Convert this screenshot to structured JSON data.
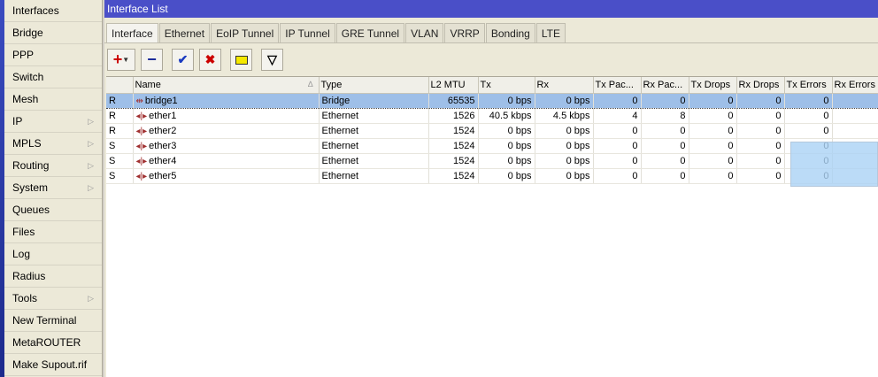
{
  "sidebar": {
    "items": [
      {
        "label": "Interfaces",
        "submenu": false
      },
      {
        "label": "Bridge",
        "submenu": false
      },
      {
        "label": "PPP",
        "submenu": false
      },
      {
        "label": "Switch",
        "submenu": false
      },
      {
        "label": "Mesh",
        "submenu": false
      },
      {
        "label": "IP",
        "submenu": true
      },
      {
        "label": "MPLS",
        "submenu": true
      },
      {
        "label": "Routing",
        "submenu": true
      },
      {
        "label": "System",
        "submenu": true
      },
      {
        "label": "Queues",
        "submenu": false
      },
      {
        "label": "Files",
        "submenu": false
      },
      {
        "label": "Log",
        "submenu": false
      },
      {
        "label": "Radius",
        "submenu": false
      },
      {
        "label": "Tools",
        "submenu": true
      },
      {
        "label": "New Terminal",
        "submenu": false
      },
      {
        "label": "MetaROUTER",
        "submenu": false
      },
      {
        "label": "Make Supout.rif",
        "submenu": false
      }
    ]
  },
  "window": {
    "title": "Interface List"
  },
  "tabs": [
    "Interface",
    "Ethernet",
    "EoIP Tunnel",
    "IP Tunnel",
    "GRE Tunnel",
    "VLAN",
    "VRRP",
    "Bonding",
    "LTE"
  ],
  "active_tab": 0,
  "toolbar": {
    "add": "+",
    "remove": "−",
    "enable": "✔",
    "disable": "✖",
    "comment": "▭",
    "filter": "▽"
  },
  "table": {
    "columns": [
      "",
      "Name",
      "Type",
      "L2 MTU",
      "Tx",
      "Rx",
      "Tx Pac...",
      "Rx Pac...",
      "Tx Drops",
      "Rx Drops",
      "Tx Errors",
      "Rx Errors"
    ],
    "rows": [
      {
        "flag": "R",
        "icon": "bridge-icon",
        "name": "bridge1",
        "type": "Bridge",
        "l2mtu": "65535",
        "tx": "0 bps",
        "rx": "0 bps",
        "txp": "0",
        "rxp": "0",
        "txd": "0",
        "rxd": "0",
        "txe": "0",
        "rxe": "",
        "selected": true
      },
      {
        "flag": "R",
        "icon": "ethernet-icon",
        "name": "ether1",
        "type": "Ethernet",
        "l2mtu": "1526",
        "tx": "40.5 kbps",
        "rx": "4.5 kbps",
        "txp": "4",
        "rxp": "8",
        "txd": "0",
        "rxd": "0",
        "txe": "0",
        "rxe": ""
      },
      {
        "flag": "R",
        "icon": "ethernet-icon",
        "name": "ether2",
        "type": "Ethernet",
        "l2mtu": "1524",
        "tx": "0 bps",
        "rx": "0 bps",
        "txp": "0",
        "rxp": "0",
        "txd": "0",
        "rxd": "0",
        "txe": "0",
        "rxe": ""
      },
      {
        "flag": "S",
        "icon": "ethernet-icon",
        "name": "ether3",
        "type": "Ethernet",
        "l2mtu": "1524",
        "tx": "0 bps",
        "rx": "0 bps",
        "txp": "0",
        "rxp": "0",
        "txd": "0",
        "rxd": "0",
        "txe": "0",
        "rxe": ""
      },
      {
        "flag": "S",
        "icon": "ethernet-icon",
        "name": "ether4",
        "type": "Ethernet",
        "l2mtu": "1524",
        "tx": "0 bps",
        "rx": "0 bps",
        "txp": "0",
        "rxp": "0",
        "txd": "0",
        "rxd": "0",
        "txe": "0",
        "rxe": ""
      },
      {
        "flag": "S",
        "icon": "ethernet-icon",
        "name": "ether5",
        "type": "Ethernet",
        "l2mtu": "1524",
        "tx": "0 bps",
        "rx": "0 bps",
        "txp": "0",
        "rxp": "0",
        "txd": "0",
        "rxd": "0",
        "txe": "0",
        "rxe": ""
      }
    ]
  },
  "colors": {
    "titlebar": "#4a4fc8",
    "selection": "#9ebfe8",
    "add": "#cc0000",
    "remove": "#1a2a9a",
    "enable": "#1a3ac0",
    "disable": "#cc0000"
  }
}
